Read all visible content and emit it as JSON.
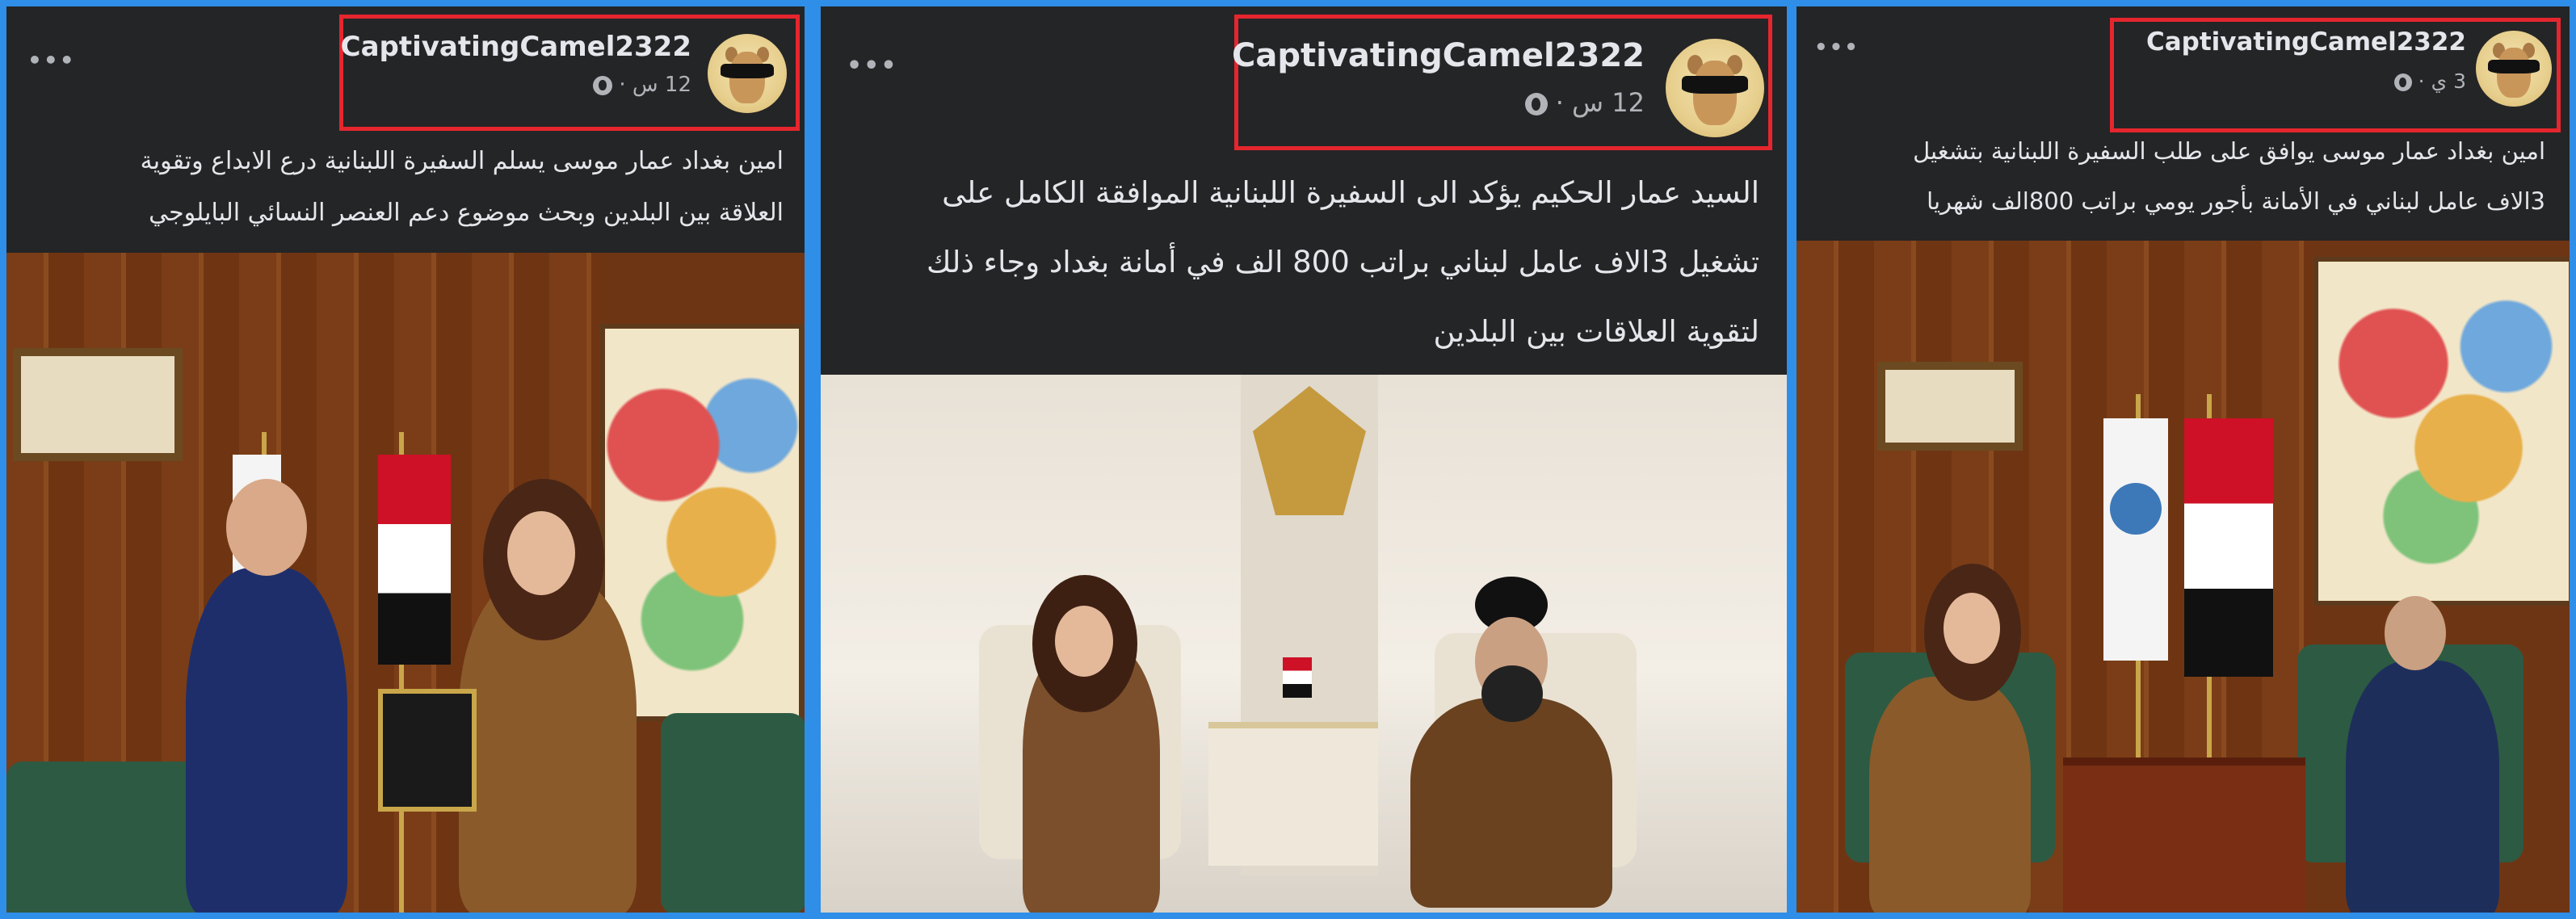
{
  "posts": [
    {
      "username": "CaptivatingCamel2322",
      "time": "12 س",
      "separator": "·",
      "more_icon": "•••",
      "icons": {
        "more": "more-options-icon",
        "privacy": "globe-icon",
        "avatar": "camel-sunglasses-avatar"
      },
      "text_lines": [
        "امين بغداد عمار موسى يسلم السفيرة اللبنانية درع الابداع وتقوية",
        "العلاقة بين البلدين وبحث موضوع دعم العنصر النسائي البايلوجي"
      ]
    },
    {
      "username": "CaptivatingCamel2322",
      "time": "12 س",
      "separator": "·",
      "more_icon": "•••",
      "icons": {
        "more": "more-options-icon",
        "privacy": "globe-icon",
        "avatar": "camel-sunglasses-avatar"
      },
      "text_lines": [
        "السيد عمار الحكيم يؤكد الى السفيرة اللبنانية الموافقة الكامل على",
        "تشغيل 3الاف عامل لبناني  براتب 800 الف في أمانة بغداد وجاء ذلك",
        "لتقوية العلاقات بين البلدين"
      ]
    },
    {
      "username": "CaptivatingCamel2322",
      "time": "3 ي",
      "separator": "·",
      "more_icon": "•••",
      "icons": {
        "more": "more-options-icon",
        "privacy": "globe-icon",
        "avatar": "camel-sunglasses-avatar"
      },
      "text_lines": [
        "امين بغداد عمار موسى يوافق على طلب السفيرة اللبنانية بتشغيل",
        "3الاف عامل  لبناني في الأمانة بأجور يومي براتب 800الف شهريا"
      ]
    }
  ],
  "colors": {
    "background_border": "#2f8ee8",
    "panel_bg": "#242526",
    "highlight_box": "#e5262e",
    "text_primary": "#e4e6eb",
    "text_secondary": "#b0b3b8"
  }
}
